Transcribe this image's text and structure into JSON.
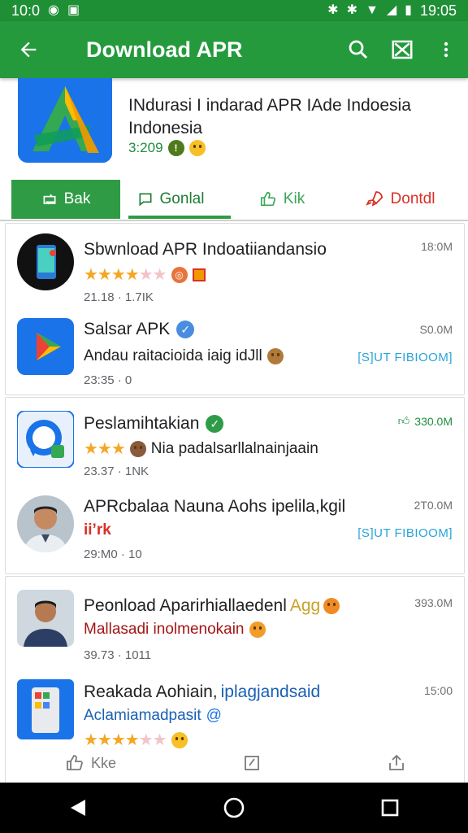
{
  "status_bar": {
    "time_left": "10:0",
    "time_right": "19:05"
  },
  "appbar": {
    "title": "Download APR"
  },
  "hero": {
    "title": "INdurasi I indarad APR IAde Indoesia Indonesia",
    "meta": "3:209"
  },
  "tabs": [
    {
      "label": "Bak"
    },
    {
      "label": "Gonlal"
    },
    {
      "label": "Kik"
    },
    {
      "label": "Dontdl"
    }
  ],
  "items": [
    {
      "name": "Sbwnload APR Indoatiiandansio",
      "time": "18:0M",
      "rating_stars": 4,
      "meta": "21.18 · 1.7IK"
    },
    {
      "name": "Salsar APK",
      "time": "S0.0M",
      "line2": "Andau raitacioida iaig idJll",
      "action": "[S]UT FIBIOOM]",
      "meta": "23:35 · 0"
    },
    {
      "name": "Peslamihtakian",
      "time": "330.0M",
      "rating_stars": 3,
      "line2": "Nia padalsarllalnainjaain",
      "meta": "23.37 · 1NK"
    },
    {
      "name": "APRcbalaa Nauna Aohs ipelila,kgil",
      "time": "2T0.0M",
      "line2": "ii’rk",
      "action": "[S]UT FIBIOOM]",
      "meta": "29:M0 · 10"
    },
    {
      "name": "Peonload Aparirhiallaedenl",
      "name_tail": "Agg",
      "time": "393.0M",
      "line2": "Mallasadi inolmenokain",
      "meta": "39.73 · 1011"
    },
    {
      "name": "Reakada Aohiain,",
      "name_tail": "iplagjandsaid",
      "time": "15:00",
      "line2": "Aclamiamadpasit",
      "rating_stars": 4
    }
  ],
  "bottom_actions": {
    "like": "Kke"
  },
  "colors": {
    "primary": "#249a3c",
    "accent_red": "#d93025",
    "link_blue": "#29a3d9",
    "star": "#f5a623"
  }
}
